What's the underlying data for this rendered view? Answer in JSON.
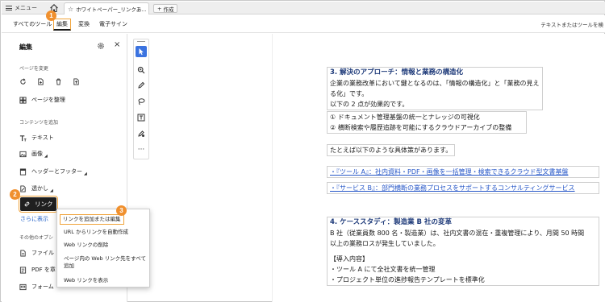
{
  "tabbar": {
    "menu_label": "メニュー",
    "doc_tab_title": "ホワイトペーパー_リンクあ...",
    "new_tab_label": "作成"
  },
  "toolbar": {
    "items": [
      "すべてのツール",
      "編集",
      "変換",
      "電子サイン"
    ],
    "search_hint": "テキストまたはツールを検"
  },
  "badges": [
    "1",
    "2",
    "3"
  ],
  "panel": {
    "title": "編集",
    "section_pages": "ページを変更",
    "organize_label": "ページを整理",
    "section_content": "コンテンツを追加",
    "text_label": "テキスト",
    "image_label": "画像",
    "header_footer_label": "ヘッダーとフッター",
    "watermark_label": "透かし",
    "link_label": "リンク",
    "more_label": "さらに表示",
    "section_other": "その他のオプシ",
    "file_label": "ファイル",
    "pdf_label": "PDF を章",
    "form_label": "フォーム"
  },
  "popup": {
    "items": [
      "リンクを追加または編集",
      "URL からリンクを自動作成",
      "Web リンクの削除",
      "ページ内の Web リンク先をすべて",
      "追加",
      "Web リンクを表示"
    ]
  },
  "document": {
    "heading3": "3. 解決のアプローチ：情報と業務の構造化",
    "p1_line1": "企業の業務改革において鍵となるのは、「情報の構造化」と「業務の見える化」です。",
    "p1_line2": "以下の 2 点が効果的です。",
    "list1": "① ドキュメント管理基盤の統一とナレッジの可視化",
    "list2": "② 横断検索や履歴追跡を可能にするクラウドアーカイブの整備",
    "examples_intro": "たとえば以下のような具体策があります。",
    "tool_a": "・『ツール A』：社内資料・PDF・画像を一括管理・検索できるクラウド型文書基盤",
    "service_b": "・『サービス B』：部門横断の業務プロセスをサポートするコンサルティングサービス",
    "heading4": "4. ケーススタディ：製造業 B 社の変革",
    "case_line1": "B 社（従業員数 800 名・製造業）は、社内文書の混在・重複管理により、月間 50 時間",
    "case_line2": "以上の業務ロスが発生していました。",
    "intro_label": "【導入内容】",
    "intro_item1": "・ツール A にて全社文書を統一管理",
    "intro_item2": "・プロジェクト単位の進捗報告テンプレートを標準化"
  },
  "colors": {
    "accent": "#f0902e",
    "link": "#2858c8",
    "active_tool": "#3b73e0"
  }
}
